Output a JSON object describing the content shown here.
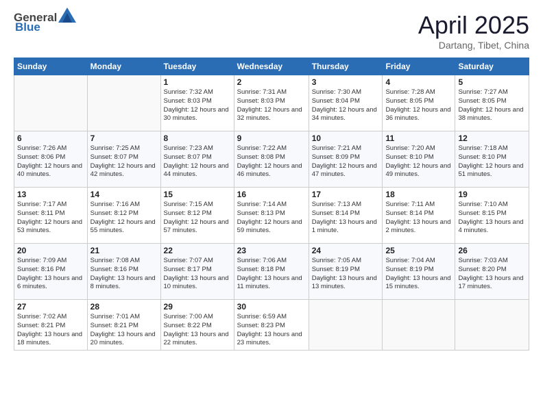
{
  "logo": {
    "general": "General",
    "blue": "Blue"
  },
  "title": "April 2025",
  "subtitle": "Dartang, Tibet, China",
  "weekdays": [
    "Sunday",
    "Monday",
    "Tuesday",
    "Wednesday",
    "Thursday",
    "Friday",
    "Saturday"
  ],
  "weeks": [
    [
      {
        "day": "",
        "sunrise": "",
        "sunset": "",
        "daylight": ""
      },
      {
        "day": "",
        "sunrise": "",
        "sunset": "",
        "daylight": ""
      },
      {
        "day": "1",
        "sunrise": "Sunrise: 7:32 AM",
        "sunset": "Sunset: 8:03 PM",
        "daylight": "Daylight: 12 hours and 30 minutes."
      },
      {
        "day": "2",
        "sunrise": "Sunrise: 7:31 AM",
        "sunset": "Sunset: 8:03 PM",
        "daylight": "Daylight: 12 hours and 32 minutes."
      },
      {
        "day": "3",
        "sunrise": "Sunrise: 7:30 AM",
        "sunset": "Sunset: 8:04 PM",
        "daylight": "Daylight: 12 hours and 34 minutes."
      },
      {
        "day": "4",
        "sunrise": "Sunrise: 7:28 AM",
        "sunset": "Sunset: 8:05 PM",
        "daylight": "Daylight: 12 hours and 36 minutes."
      },
      {
        "day": "5",
        "sunrise": "Sunrise: 7:27 AM",
        "sunset": "Sunset: 8:05 PM",
        "daylight": "Daylight: 12 hours and 38 minutes."
      }
    ],
    [
      {
        "day": "6",
        "sunrise": "Sunrise: 7:26 AM",
        "sunset": "Sunset: 8:06 PM",
        "daylight": "Daylight: 12 hours and 40 minutes."
      },
      {
        "day": "7",
        "sunrise": "Sunrise: 7:25 AM",
        "sunset": "Sunset: 8:07 PM",
        "daylight": "Daylight: 12 hours and 42 minutes."
      },
      {
        "day": "8",
        "sunrise": "Sunrise: 7:23 AM",
        "sunset": "Sunset: 8:07 PM",
        "daylight": "Daylight: 12 hours and 44 minutes."
      },
      {
        "day": "9",
        "sunrise": "Sunrise: 7:22 AM",
        "sunset": "Sunset: 8:08 PM",
        "daylight": "Daylight: 12 hours and 46 minutes."
      },
      {
        "day": "10",
        "sunrise": "Sunrise: 7:21 AM",
        "sunset": "Sunset: 8:09 PM",
        "daylight": "Daylight: 12 hours and 47 minutes."
      },
      {
        "day": "11",
        "sunrise": "Sunrise: 7:20 AM",
        "sunset": "Sunset: 8:10 PM",
        "daylight": "Daylight: 12 hours and 49 minutes."
      },
      {
        "day": "12",
        "sunrise": "Sunrise: 7:18 AM",
        "sunset": "Sunset: 8:10 PM",
        "daylight": "Daylight: 12 hours and 51 minutes."
      }
    ],
    [
      {
        "day": "13",
        "sunrise": "Sunrise: 7:17 AM",
        "sunset": "Sunset: 8:11 PM",
        "daylight": "Daylight: 12 hours and 53 minutes."
      },
      {
        "day": "14",
        "sunrise": "Sunrise: 7:16 AM",
        "sunset": "Sunset: 8:12 PM",
        "daylight": "Daylight: 12 hours and 55 minutes."
      },
      {
        "day": "15",
        "sunrise": "Sunrise: 7:15 AM",
        "sunset": "Sunset: 8:12 PM",
        "daylight": "Daylight: 12 hours and 57 minutes."
      },
      {
        "day": "16",
        "sunrise": "Sunrise: 7:14 AM",
        "sunset": "Sunset: 8:13 PM",
        "daylight": "Daylight: 12 hours and 59 minutes."
      },
      {
        "day": "17",
        "sunrise": "Sunrise: 7:13 AM",
        "sunset": "Sunset: 8:14 PM",
        "daylight": "Daylight: 13 hours and 1 minute."
      },
      {
        "day": "18",
        "sunrise": "Sunrise: 7:11 AM",
        "sunset": "Sunset: 8:14 PM",
        "daylight": "Daylight: 13 hours and 2 minutes."
      },
      {
        "day": "19",
        "sunrise": "Sunrise: 7:10 AM",
        "sunset": "Sunset: 8:15 PM",
        "daylight": "Daylight: 13 hours and 4 minutes."
      }
    ],
    [
      {
        "day": "20",
        "sunrise": "Sunrise: 7:09 AM",
        "sunset": "Sunset: 8:16 PM",
        "daylight": "Daylight: 13 hours and 6 minutes."
      },
      {
        "day": "21",
        "sunrise": "Sunrise: 7:08 AM",
        "sunset": "Sunset: 8:16 PM",
        "daylight": "Daylight: 13 hours and 8 minutes."
      },
      {
        "day": "22",
        "sunrise": "Sunrise: 7:07 AM",
        "sunset": "Sunset: 8:17 PM",
        "daylight": "Daylight: 13 hours and 10 minutes."
      },
      {
        "day": "23",
        "sunrise": "Sunrise: 7:06 AM",
        "sunset": "Sunset: 8:18 PM",
        "daylight": "Daylight: 13 hours and 11 minutes."
      },
      {
        "day": "24",
        "sunrise": "Sunrise: 7:05 AM",
        "sunset": "Sunset: 8:19 PM",
        "daylight": "Daylight: 13 hours and 13 minutes."
      },
      {
        "day": "25",
        "sunrise": "Sunrise: 7:04 AM",
        "sunset": "Sunset: 8:19 PM",
        "daylight": "Daylight: 13 hours and 15 minutes."
      },
      {
        "day": "26",
        "sunrise": "Sunrise: 7:03 AM",
        "sunset": "Sunset: 8:20 PM",
        "daylight": "Daylight: 13 hours and 17 minutes."
      }
    ],
    [
      {
        "day": "27",
        "sunrise": "Sunrise: 7:02 AM",
        "sunset": "Sunset: 8:21 PM",
        "daylight": "Daylight: 13 hours and 18 minutes."
      },
      {
        "day": "28",
        "sunrise": "Sunrise: 7:01 AM",
        "sunset": "Sunset: 8:21 PM",
        "daylight": "Daylight: 13 hours and 20 minutes."
      },
      {
        "day": "29",
        "sunrise": "Sunrise: 7:00 AM",
        "sunset": "Sunset: 8:22 PM",
        "daylight": "Daylight: 13 hours and 22 minutes."
      },
      {
        "day": "30",
        "sunrise": "Sunrise: 6:59 AM",
        "sunset": "Sunset: 8:23 PM",
        "daylight": "Daylight: 13 hours and 23 minutes."
      },
      {
        "day": "",
        "sunrise": "",
        "sunset": "",
        "daylight": ""
      },
      {
        "day": "",
        "sunrise": "",
        "sunset": "",
        "daylight": ""
      },
      {
        "day": "",
        "sunrise": "",
        "sunset": "",
        "daylight": ""
      }
    ]
  ]
}
